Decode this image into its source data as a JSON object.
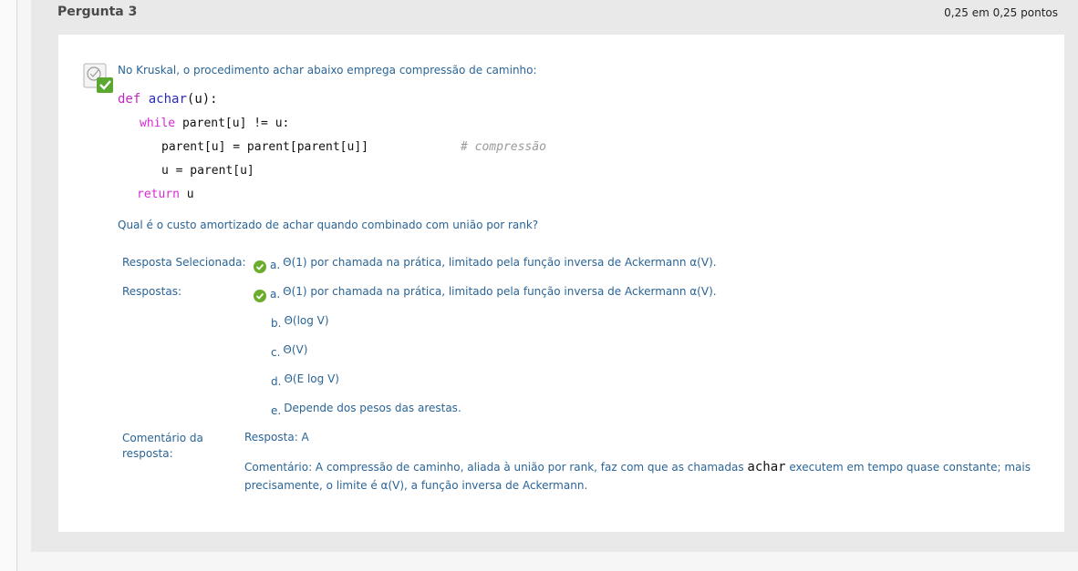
{
  "question": {
    "title": "Pergunta 3",
    "score": "0,25 em 0,25 pontos",
    "prompt": "No Kruskal, o procedimento achar abaixo emprega compressão de caminho:",
    "code": {
      "line1_kw": "def",
      "line1_fn": "achar",
      "line1_rest": "(u):",
      "line2_kw": "while",
      "line2_rest": " parent[u] != u:",
      "line3_code": "parent[u] = parent[parent[u]]",
      "line3_comment": "# compressão",
      "line4_code": "u = parent[u]",
      "line5_kw": "return",
      "line5_rest": " u"
    },
    "ask": "Qual é o custo amortizado de achar quando combinado com união por rank?"
  },
  "labels": {
    "selected": "Resposta Selecionada:",
    "answers": "Respostas:",
    "feedback_line1": "Comentário da",
    "feedback_line2": "resposta:"
  },
  "selected_answer": {
    "letter": "a.",
    "text": "Θ(1) por chamada na prática, limitado pela função inversa de Ackermann α(V)."
  },
  "answers": [
    {
      "letter": "a.",
      "text": "Θ(1) por chamada na prática, limitado pela função inversa de Ackermann α(V).",
      "correct": true
    },
    {
      "letter": "b.",
      "text": "Θ(log V)",
      "correct": false
    },
    {
      "letter": "c.",
      "text": "Θ(V)",
      "correct": false
    },
    {
      "letter": "d.",
      "text": "Θ(E log V)",
      "correct": false
    },
    {
      "letter": "e.",
      "text": "Depende dos pesos das arestas.",
      "correct": false
    }
  ],
  "feedback": {
    "answer": "Resposta: A",
    "comment_prefix": "Comentário: A compressão de caminho, aliada à união por rank, faz com que as chamadas ",
    "comment_code": "achar",
    "comment_suffix": " executem em tempo quase constante; mais precisamente, o limite é α(V), a função inversa de Ackermann."
  },
  "colors": {
    "link": "#2a6496",
    "check": "#6aac2b"
  }
}
